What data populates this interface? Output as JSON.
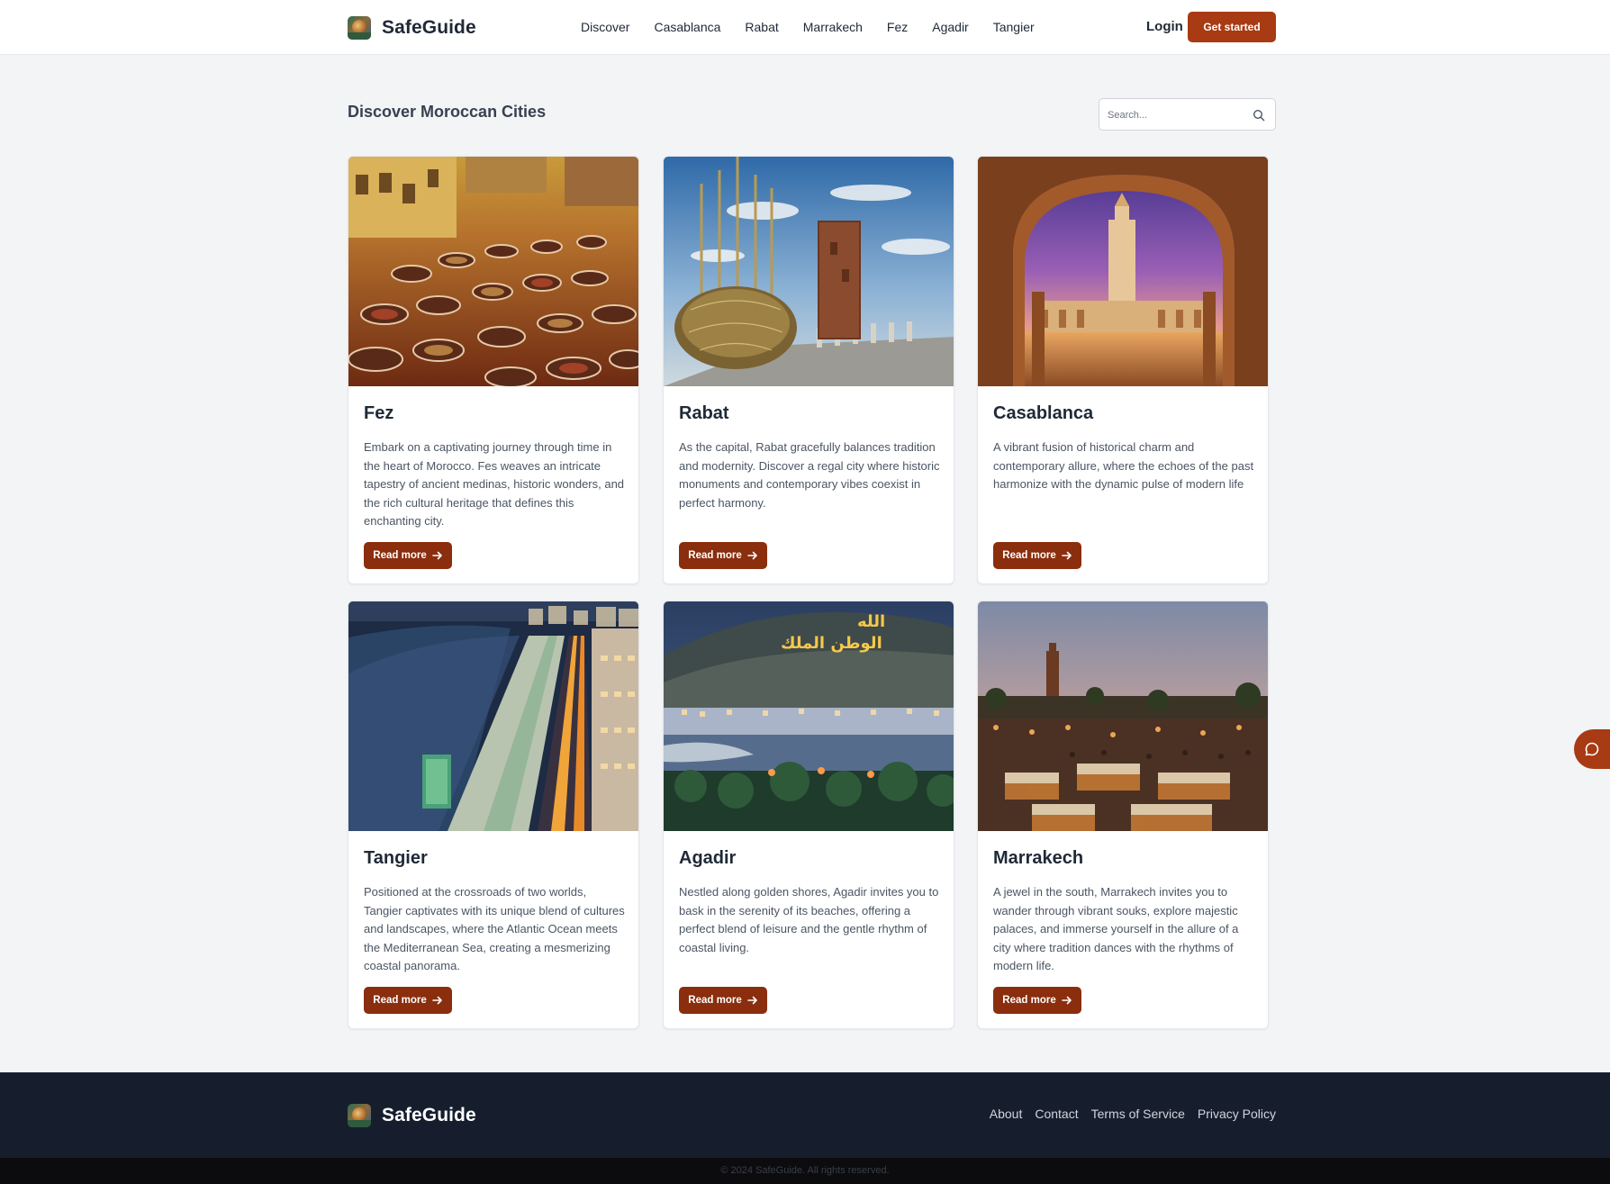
{
  "colors": {
    "accent": "#a83a14",
    "button_dark": "#8a2e0e",
    "page_background": "#f3f4f6",
    "footer_background": "#161e2e"
  },
  "header": {
    "brand": "SafeGuide",
    "logo_icon": "moroccan-scene-logo",
    "nav": [
      "Discover",
      "Casablanca",
      "Rabat",
      "Marrakech",
      "Fez",
      "Agadir",
      "Tangier"
    ],
    "login_label": "Login",
    "cta_label": "Get started"
  },
  "main": {
    "title": "Discover Moroccan Cities",
    "search": {
      "placeholder": "Search...",
      "icon": "search-icon"
    },
    "cards": [
      {
        "title": "Fez",
        "image": "fez-tanneries-photo",
        "description": "Embark on a captivating journey through time in the heart of Morocco. Fes weaves an intricate tapestry of ancient medinas, historic wonders, and the rich cultural heritage that defines this enchanting city.",
        "button": "Read more"
      },
      {
        "title": "Rabat",
        "image": "rabat-hassan-tower-photo",
        "description": "As the capital, Rabat gracefully balances tradition and modernity. Discover a regal city where historic monuments and contemporary vibes coexist in perfect harmony.",
        "button": "Read more"
      },
      {
        "title": "Casablanca",
        "image": "casablanca-mosque-photo",
        "description": "A vibrant fusion of historical charm and contemporary allure, where the echoes of the past harmonize with the dynamic pulse of modern life",
        "button": "Read more"
      },
      {
        "title": "Tangier",
        "image": "tangier-coast-night-photo",
        "description": "Positioned at the crossroads of two worlds, Tangier captivates with its unique blend of cultures and landscapes, where the Atlantic Ocean meets the Mediterranean Sea, creating a mesmerizing coastal panorama.",
        "button": "Read more"
      },
      {
        "title": "Agadir",
        "image": "agadir-bay-dusk-photo",
        "description": "Nestled along golden shores, Agadir invites you to bask in the serenity of its beaches, offering a perfect blend of leisure and the gentle rhythm of coastal living.",
        "button": "Read more"
      },
      {
        "title": "Marrakech",
        "image": "marrakech-square-photo",
        "description": "A jewel in the south, Marrakech invites you to wander through vibrant souks, explore majestic palaces, and immerse yourself in the allure of a city where tradition dances with the rhythms of modern life.",
        "button": "Read more"
      }
    ]
  },
  "chat": {
    "icon": "chat-bubble-icon"
  },
  "footer": {
    "brand": "SafeGuide",
    "links": [
      "About",
      "Contact",
      "Terms of Service",
      "Privacy Policy"
    ],
    "copyright": "© 2024 SafeGuide. All rights reserved."
  }
}
